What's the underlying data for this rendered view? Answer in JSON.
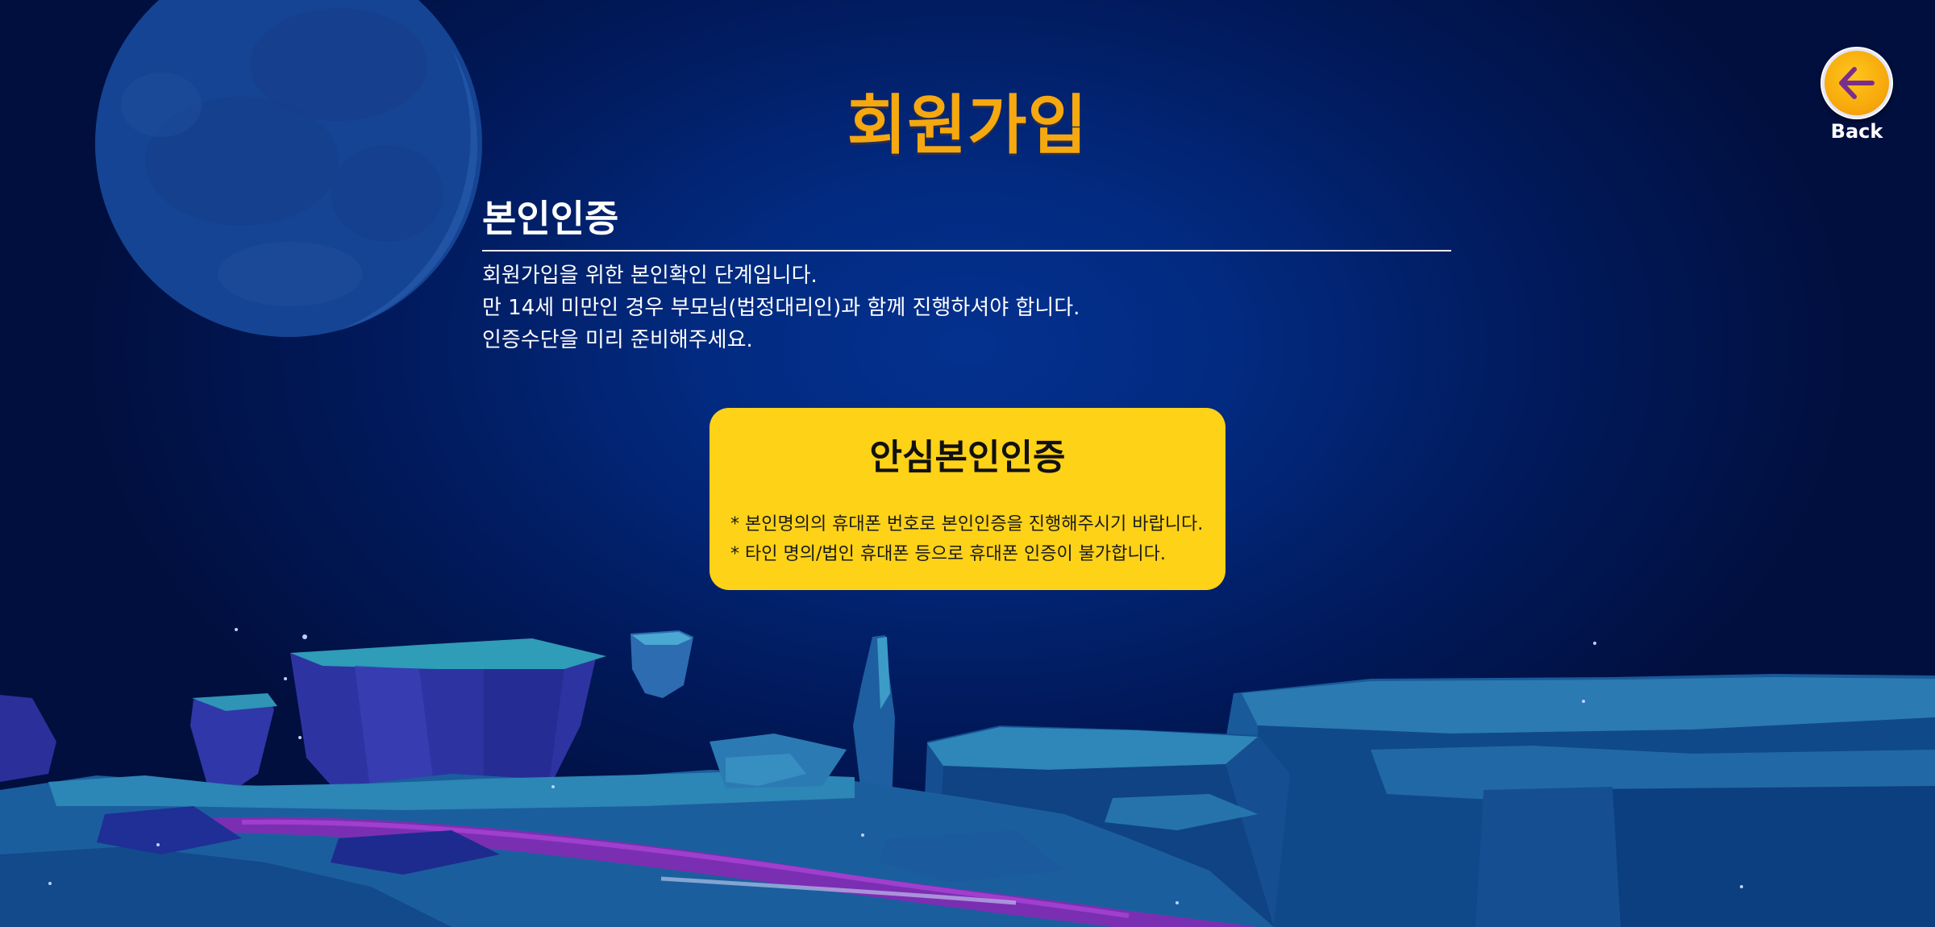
{
  "page": {
    "title": "회원가입"
  },
  "identity": {
    "heading": "본인인증",
    "lines": [
      "회원가입을 위한 본인확인 단계입니다.",
      "만 14세 미만인 경우 부모님(법정대리인)과 함께 진행하셔야 합니다.",
      "인증수단을 미리 준비해주세요."
    ]
  },
  "auth_option": {
    "title": "안심본인인증",
    "notes": [
      "* 본인명의의 휴대폰 번호로 본인인증을 진행해주시기 바랍니다.",
      "* 타인 명의/법인 휴대폰 등으로 휴대폰 인증이 불가합니다."
    ]
  },
  "nav": {
    "back_label": "Back",
    "back_icon": "arrow-left-icon"
  },
  "colors": {
    "background": "#022a80",
    "title": "#f5a80f",
    "card": "#fed217",
    "back_button": "#f7a80b"
  }
}
